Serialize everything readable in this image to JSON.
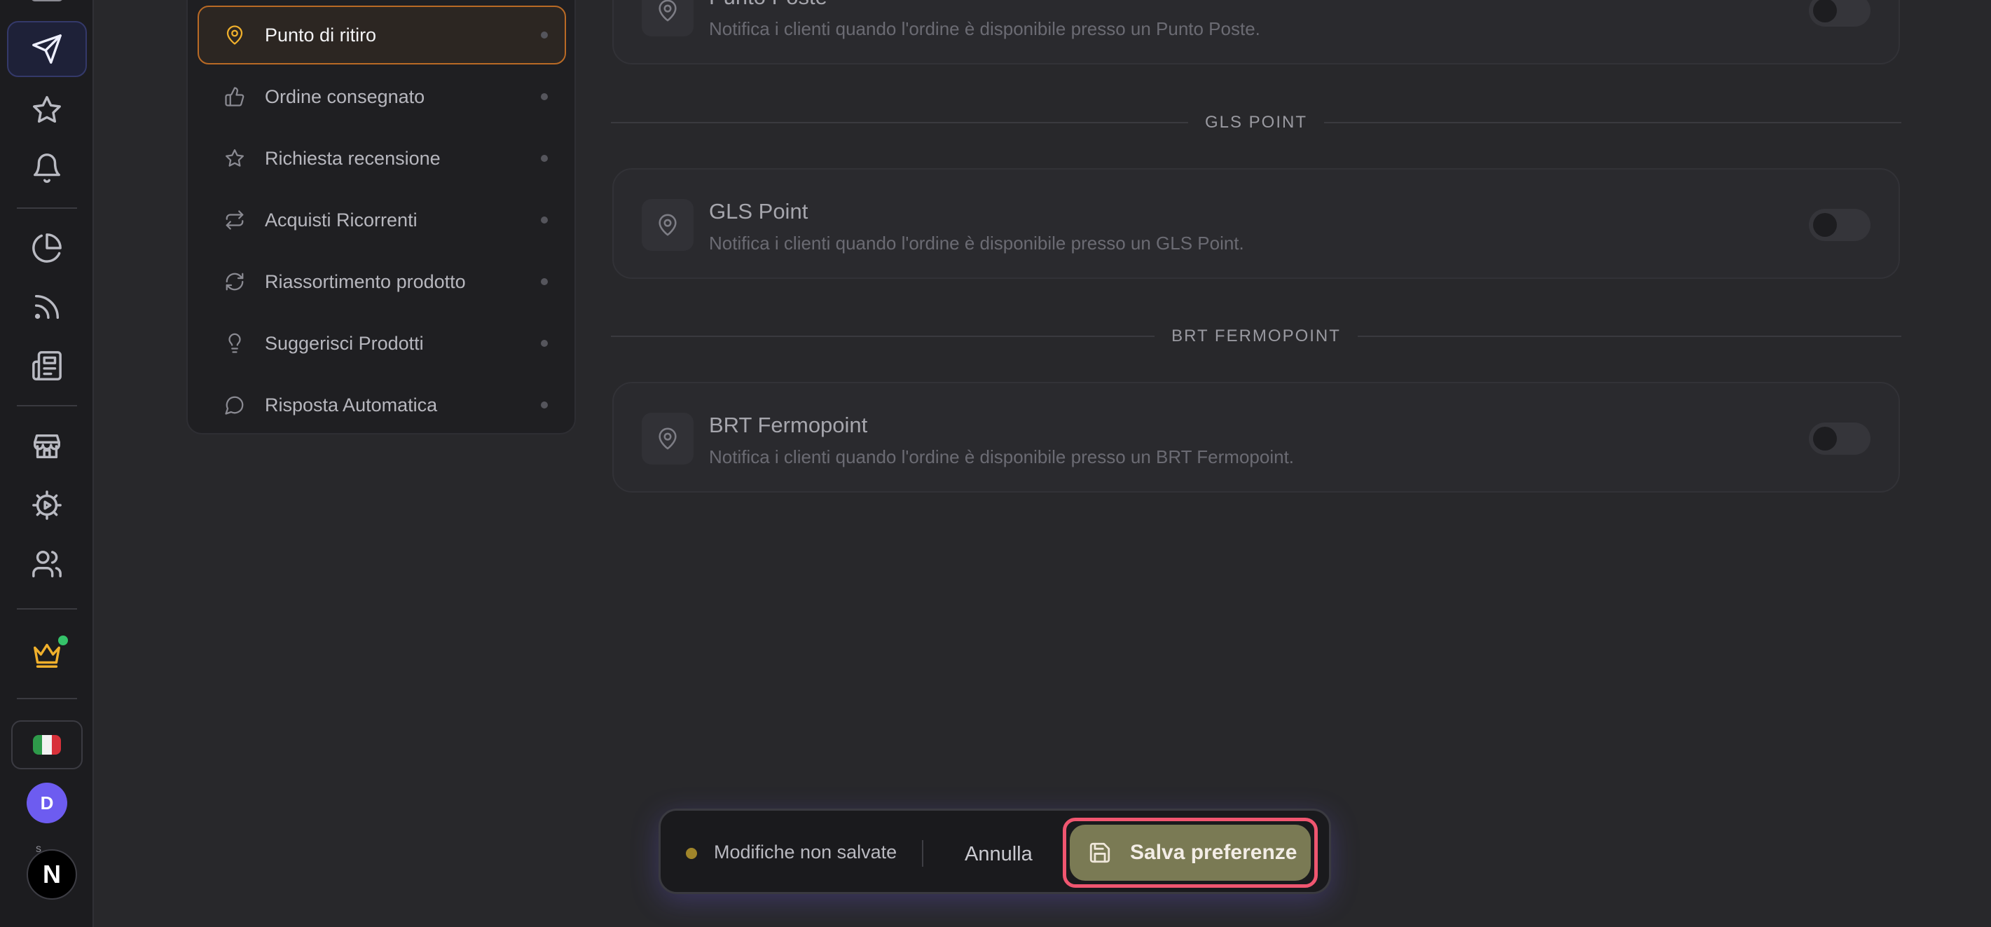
{
  "sidebar": {
    "rail_icons": [
      "document-stub-icon",
      "send-icon",
      "star-icon",
      "bell-icon",
      "pie-chart-icon",
      "rss-icon",
      "newspaper-icon",
      "store-icon",
      "settings-icon",
      "users-icon",
      "crown-icon"
    ],
    "active_item": "send-icon",
    "language_flag": "italy-flag",
    "avatar_initial": "D",
    "small_mark": "s",
    "logo_letter": "N"
  },
  "menu": {
    "items": [
      {
        "label": "Punto di ritiro",
        "icon": "map-pin-icon",
        "active": true
      },
      {
        "label": "Ordine consegnato",
        "icon": "thumbs-up-icon"
      },
      {
        "label": "Richiesta recensione",
        "icon": "star-icon"
      },
      {
        "label": "Acquisti Ricorrenti",
        "icon": "repeat-icon"
      },
      {
        "label": "Riassortimento prodotto",
        "icon": "refresh-icon"
      },
      {
        "label": "Suggerisci Prodotti",
        "icon": "lightbulb-icon"
      },
      {
        "label": "Risposta Automatica",
        "icon": "message-circle-icon"
      }
    ]
  },
  "sections": [
    {
      "heading": "",
      "title": "Punto Poste",
      "description": "Notifica i clienti quando l'ordine è disponibile presso un Punto Poste.",
      "enabled": false
    },
    {
      "heading": "GLS POINT",
      "title": "GLS Point",
      "description": "Notifica i clienti quando l'ordine è disponibile presso un GLS Point.",
      "enabled": false
    },
    {
      "heading": "BRT FERMOPOINT",
      "title": "BRT Fermopoint",
      "description": "Notifica i clienti quando l'ordine è disponibile presso un BRT Fermopoint.",
      "enabled": false
    }
  ],
  "save_bar": {
    "status_text": "Modifiche non salvate",
    "cancel_label": "Annulla",
    "save_label": "Salva preferenze"
  },
  "colors": {
    "accent": "#f0b02c",
    "active_border": "#b96a25",
    "save_button": "#7a7a54",
    "highlight_outline": "#f05670"
  }
}
